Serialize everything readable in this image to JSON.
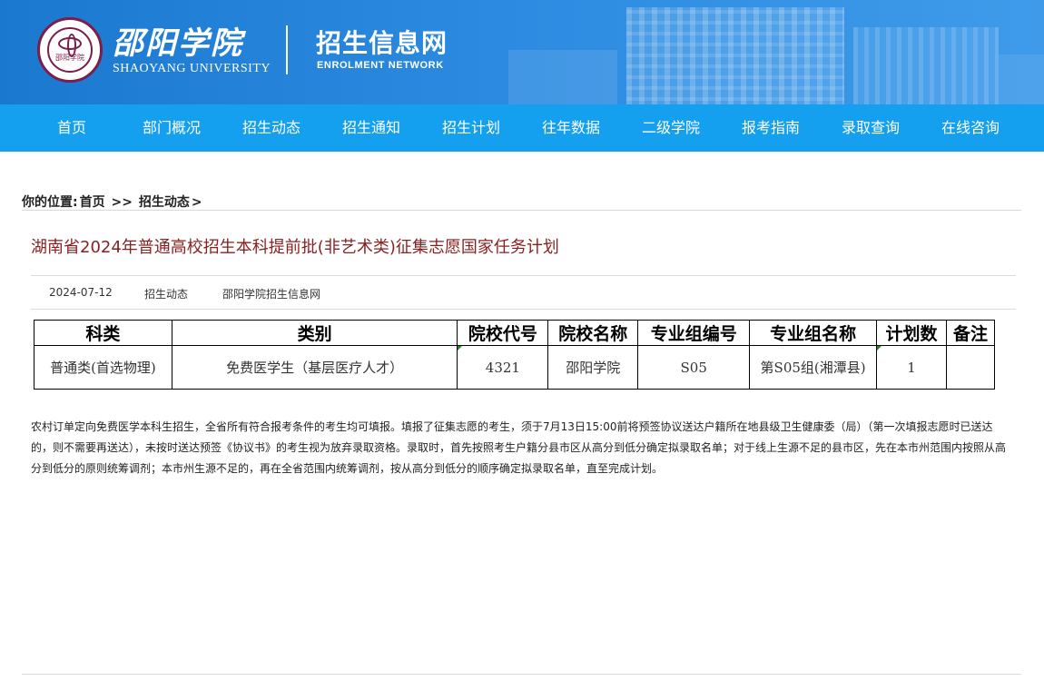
{
  "header": {
    "school_name": "邵阳学院",
    "school_name_en": "SHAOYANG UNIVERSITY",
    "site_name": "招生信息网",
    "site_name_en": "ENROLMENT NETWORK",
    "accent_color": "#14a0ee"
  },
  "nav": {
    "items": [
      {
        "label": "首页"
      },
      {
        "label": "部门概况"
      },
      {
        "label": "招生动态"
      },
      {
        "label": "招生通知"
      },
      {
        "label": "招生计划"
      },
      {
        "label": "往年数据"
      },
      {
        "label": "二级学院"
      },
      {
        "label": "报考指南"
      },
      {
        "label": "录取查询"
      },
      {
        "label": "在线咨询"
      }
    ]
  },
  "breadcrumb": {
    "prefix": "你的位置:",
    "home": "首页",
    "sep": ">>",
    "current": "招生动态",
    "trail": ">"
  },
  "article": {
    "title": "湖南省2024年普通高校招生本科提前批(非艺术类)征集志愿国家任务计划",
    "date": "2024-07-12",
    "category": "招生动态",
    "source": "邵阳学院招生信息网"
  },
  "table": {
    "headers": [
      "科类",
      "类别",
      "院校代号",
      "院校名称",
      "专业组编号",
      "专业组名称",
      "计划数",
      "备注"
    ],
    "rows": [
      [
        "普通类(首选物理)",
        "免费医学生（基层医疗人才）",
        "4321",
        "邵阳学院",
        "S05",
        "第S05组(湘潭县)",
        "1",
        ""
      ]
    ]
  },
  "notice": "农村订单定向免费医学本科生招生，全省所有符合报考条件的考生均可填报。填报了征集志愿的考生，须于7月13日15:00前将预签协议送达户籍所在地县级卫生健康委（局）（第一次填报志愿时已送达的，则不需要再送达），未按时送达预签《协议书》的考生视为放弃录取资格。录取时，首先按照考生户籍分县市区从高分到低分确定拟录取名单；对于线上生源不足的县市区，先在本市州范围内按照从高分到低分的原则统筹调剂；本市州生源不足的，再在全省范围内统筹调剂，按从高分到低分的顺序确定拟录取名单，直至完成计划。"
}
